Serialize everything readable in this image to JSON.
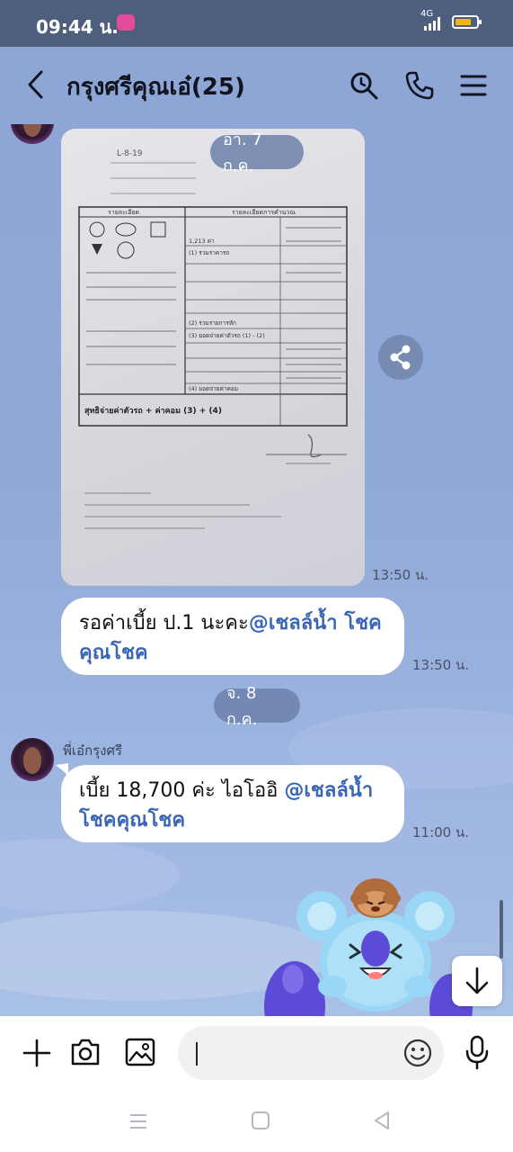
{
  "status_bar": {
    "time": "09:44 น.",
    "network": "4G"
  },
  "header": {
    "title": "กรุงศรีคุณเอ๋(25)"
  },
  "document_photo": {
    "doc_no": "L-8-19",
    "section_payee": "รายละเอียด",
    "section_calc": "รายละเอียดการคำนวณ",
    "lines": [
      "1,213 ค่า",
      "(1) รวมราคารถ",
      "(2) รวมรายการหัก",
      "(3) ยอดจ่ายค่าตัวรถ (1) - (2)",
      "(4) ยอดจ่ายค่าคอม"
    ],
    "total_line": "สุทธิจ่ายค่าตัวรถ + ค่าคอม (3) + (4)"
  },
  "messages": [
    {
      "type": "date",
      "text": "อา. 7 ก.ค."
    },
    {
      "type": "photo",
      "time": "13:50 น."
    },
    {
      "type": "text",
      "prefix": "รอค่าเบี้ย ป.1 นะคะ",
      "mention": "@เชลล์น้ำ โชคคุณโชค",
      "time": "13:50 น."
    },
    {
      "type": "date",
      "text": "จ. 8 ก.ค."
    },
    {
      "type": "text",
      "sender": "พี่เอ๋กรุงศรี",
      "prefix": "เบี้ย 18,700 ค่ะ ไอโออิ ",
      "mention": "@เชลล์น้ำโชคคุณโชค",
      "time": "11:00 น."
    }
  ],
  "input": {
    "placeholder": ""
  },
  "icons": {
    "back": "chevron-left-icon",
    "search": "search-icon",
    "call": "phone-icon",
    "menu": "menu-icon",
    "share": "share-icon",
    "scroll": "arrow-down-icon",
    "add": "plus-icon",
    "camera": "camera-icon",
    "gallery": "image-icon",
    "emoji": "emoji-icon",
    "mic": "microphone-icon"
  },
  "colors": {
    "mention": "#3b66b5",
    "chat_background": "#8fa7d6",
    "status_bar": "#4e5f7e"
  }
}
